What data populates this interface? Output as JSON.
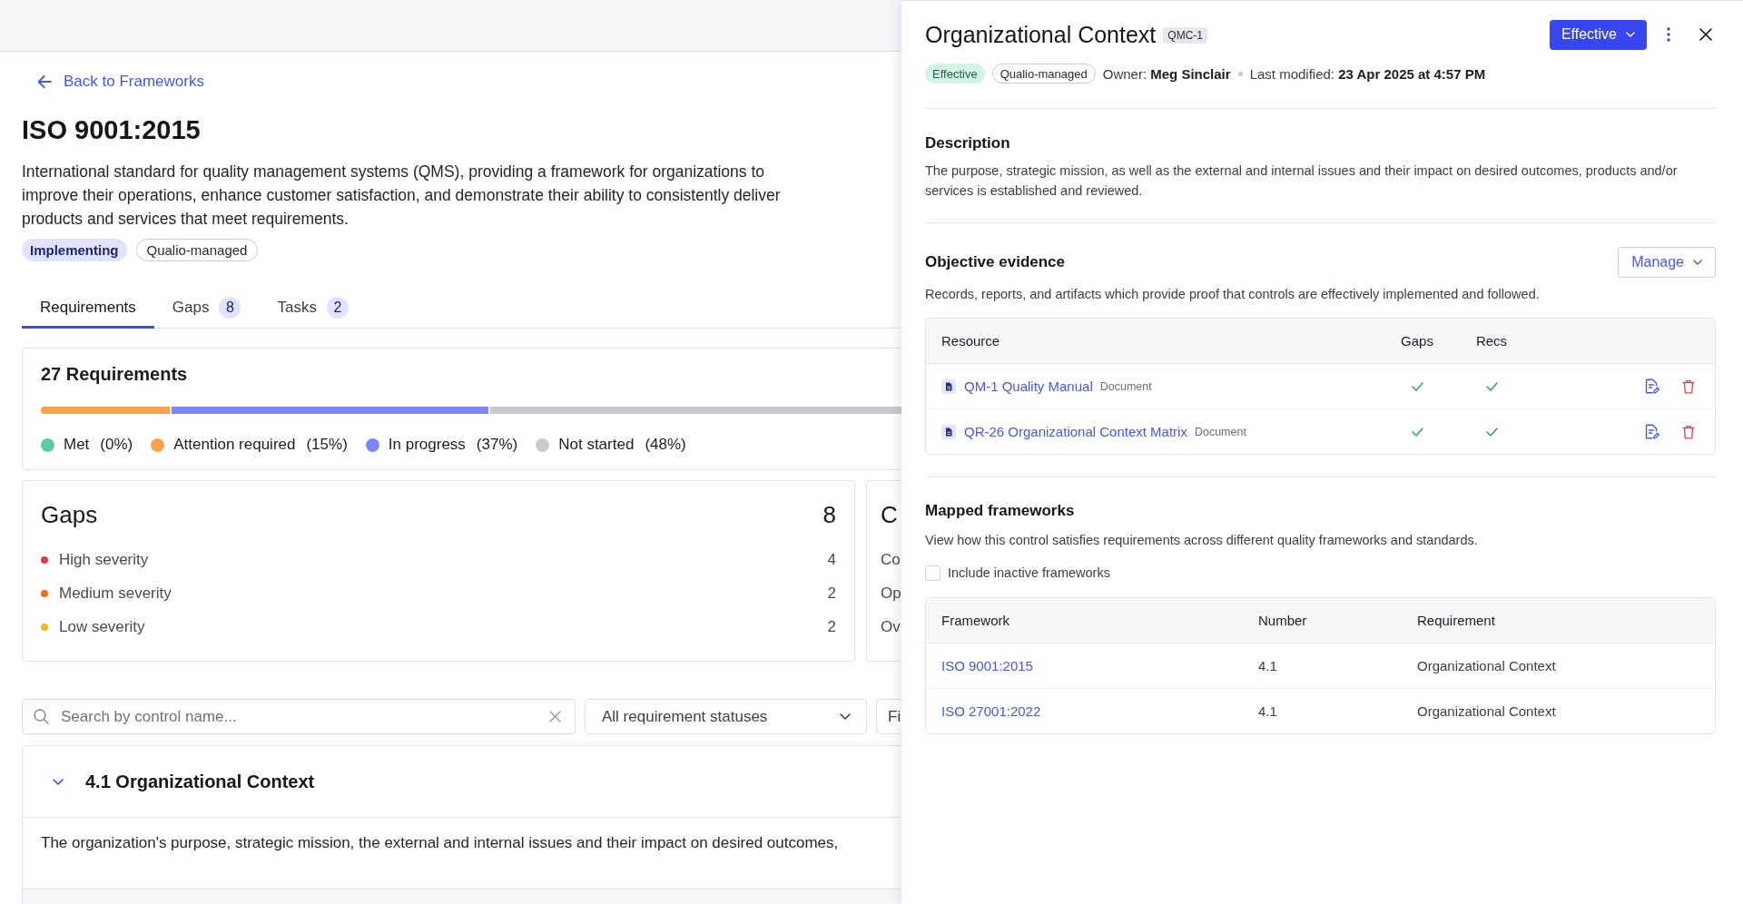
{
  "page": {
    "back_link": "Back to Frameworks",
    "title": "ISO 9001:2015",
    "description": "International standard for quality management systems (QMS), providing a framework for organizations to improve their operations, enhance customer satisfaction, and demonstrate their ability to consistently deliver products and services that meet requirements.",
    "badges": [
      {
        "label": "Implementing",
        "kind": "info"
      },
      {
        "label": "Qualio-managed",
        "kind": "outline"
      }
    ],
    "tabs": [
      {
        "label": "Requirements",
        "selected": true
      },
      {
        "label": "Gaps",
        "count": "8",
        "selected": false
      },
      {
        "label": "Tasks",
        "count": "2",
        "selected": false
      }
    ]
  },
  "requirements": {
    "title": "27 Requirements",
    "bar": [
      {
        "color": "#f9a24b",
        "level": 0.15
      },
      {
        "color": "#7d86f6",
        "level": 0.37
      },
      {
        "color": "#c8c9d2",
        "level": 0.48
      }
    ],
    "legend": [
      {
        "label": "Met",
        "percent": "(0%)",
        "color": "#5ccb9f"
      },
      {
        "label": "Attention required",
        "percent": "(15%)",
        "color": "#f9a24b"
      },
      {
        "label": "In progress",
        "percent": "(37%)",
        "color": "#7d86f6"
      },
      {
        "label": "Not started",
        "percent": "(48%)",
        "color": "#c8c9d2"
      }
    ]
  },
  "gaps": {
    "title": "Gaps",
    "count": "8",
    "rows": [
      {
        "label": "High severity",
        "count": "4",
        "color": "#df3c43"
      },
      {
        "label": "Medium severity",
        "count": "2",
        "color": "#f76c1b"
      },
      {
        "label": "Low severity",
        "count": "2",
        "color": "#f7b518"
      }
    ]
  },
  "card_2": {
    "title": "C",
    "rows": [
      {
        "label": "Co"
      },
      {
        "label": "Op"
      },
      {
        "label": "Ov"
      }
    ]
  },
  "filters": {
    "search": {
      "placeholder": "Search by control name..."
    },
    "status": {
      "value": "All requirement statuses"
    },
    "filter_3": {
      "value": "Fi"
    }
  },
  "section": {
    "title": "4.1 Organizational Context",
    "expanded": true,
    "description": "The organization's purpose, strategic mission, the external and internal issues and their impact on desired outcomes,"
  },
  "drawer": {
    "title": "Organizational Context",
    "code": "QMC-1",
    "status_button": "Effective",
    "tags": [
      {
        "label": "Effective",
        "kind": "success"
      },
      {
        "label": "Qualio-managed",
        "kind": "outline"
      }
    ],
    "owner": "Owner: **Meg Sinclair**",
    "last_modified": "Last modified: **23 Apr 2025 at 4:57 PM**",
    "description": {
      "heading": "Description",
      "text": "The purpose, strategic mission, as well as the external and internal issues and their impact on desired outcomes, products and/or services is established and reviewed."
    },
    "evidence": {
      "heading": "Objective evidence",
      "manage_button": "Manage",
      "text": "Records, reports, and artifacts which provide proof that controls are effectively implemented and followed.",
      "columns": [
        "Resource",
        "Gaps",
        "Recs"
      ],
      "rows": [
        {
          "name": "QM-1 Quality Manual",
          "type": "Document",
          "gaps_check": true,
          "recs_check": true
        },
        {
          "name": "QR-26 Organizational Context Matrix",
          "type": "Document",
          "gaps_check": true,
          "recs_check": true
        }
      ]
    },
    "mapped": {
      "heading": "Mapped frameworks",
      "text": "View how this control satisfies requirements across different quality frameworks and standards.",
      "include_inactive": {
        "label": "Include inactive frameworks",
        "checked": false
      },
      "columns": [
        "Framework",
        "Number",
        "Requirement"
      ],
      "rows": [
        {
          "framework": "ISO 9001:2015",
          "number": "4.1",
          "requirement": "Organizational Context"
        },
        {
          "framework": "ISO 27001:2022",
          "number": "4.1",
          "requirement": "Organizational Context"
        }
      ]
    }
  }
}
